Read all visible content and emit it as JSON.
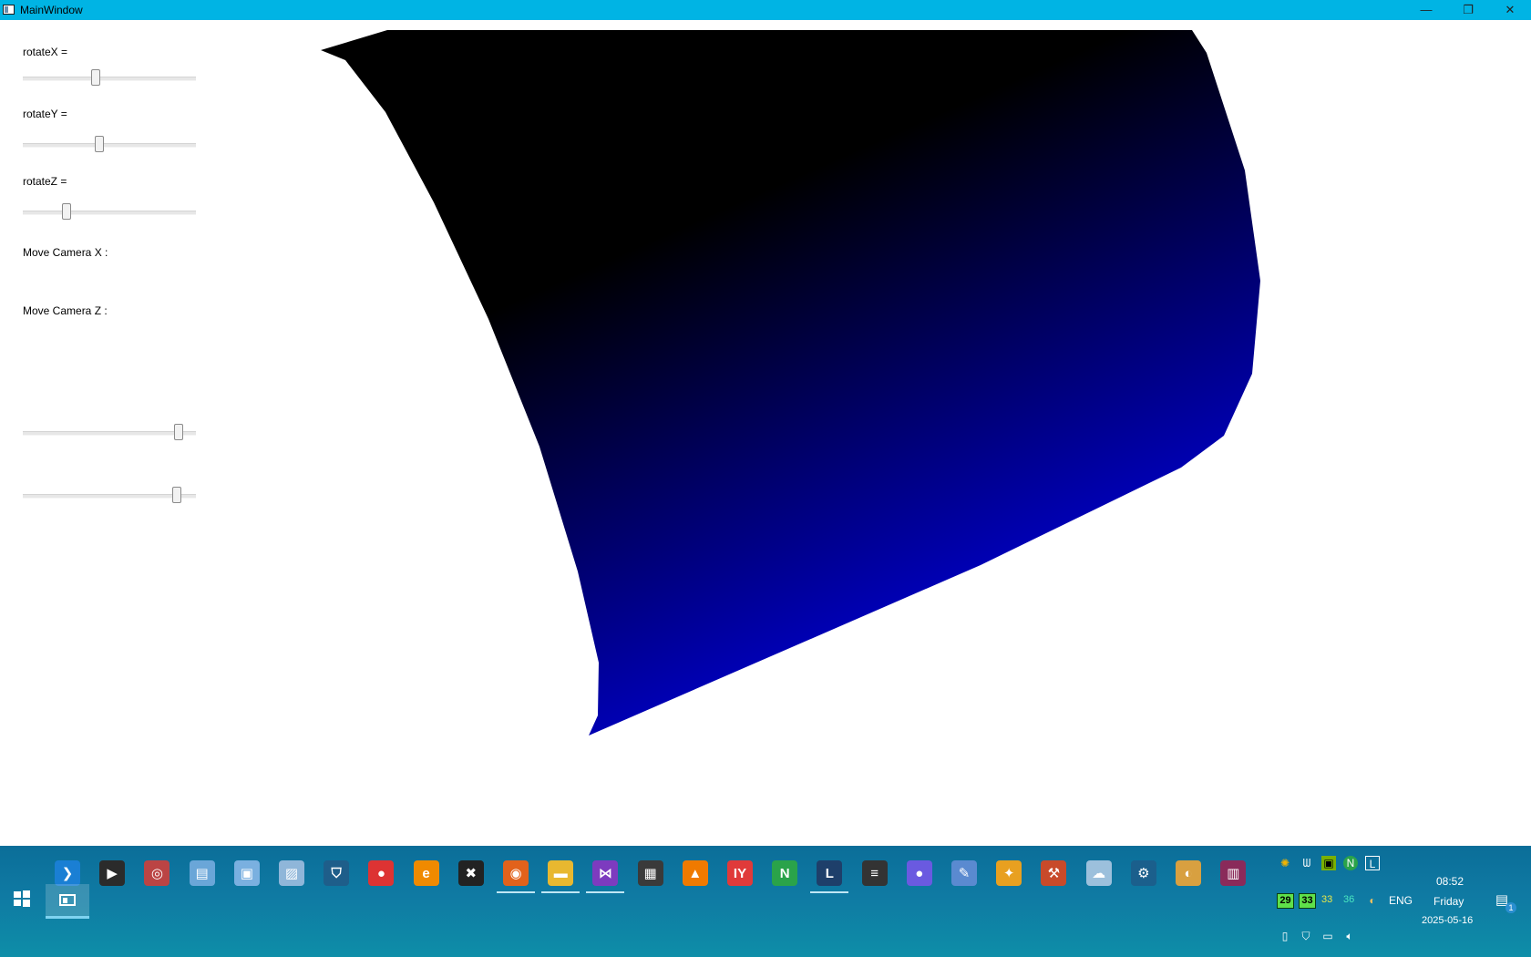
{
  "window": {
    "title": "MainWindow",
    "minimize": "—",
    "maximize": "❐",
    "close": "✕"
  },
  "controls": {
    "rotateX": {
      "label": "rotateX =",
      "value": 0.42
    },
    "rotateY": {
      "label": "rotateY =",
      "value": 0.44
    },
    "rotateZ": {
      "label": "rotateZ =",
      "value": 0.25
    },
    "moveCameraX": {
      "label": "Move Camera X :",
      "value": 0.9
    },
    "moveCameraZ": {
      "label": "Move Camera Z :",
      "value": 0.89
    }
  },
  "render": {
    "colors": {
      "top": "#000000",
      "bottom": "#0000d8",
      "background": "#ffffff"
    }
  },
  "taskbar": {
    "apps": [
      {
        "name": "vscode-icon",
        "glyph": "❯",
        "color": "#1a7fd4"
      },
      {
        "name": "media-player-icon",
        "glyph": "▶",
        "color": "#2b2b2b"
      },
      {
        "name": "globe-icon",
        "glyph": "◎",
        "color": "#b44"
      },
      {
        "name": "notes-icon",
        "glyph": "▤",
        "color": "#6aa6d8"
      },
      {
        "name": "image-viewer-icon",
        "glyph": "▣",
        "color": "#7ab0e0"
      },
      {
        "name": "photos-icon",
        "glyph": "▨",
        "color": "#8fb6d9"
      },
      {
        "name": "security-shield-icon",
        "glyph": "⛉",
        "color": "#1e5e8a"
      },
      {
        "name": "record-icon",
        "glyph": "●",
        "color": "#d33"
      },
      {
        "name": "browser-e-icon",
        "glyph": "e",
        "color": "#f08a00"
      },
      {
        "name": "x-app-icon",
        "glyph": "✖",
        "color": "#222"
      },
      {
        "name": "firefox-icon",
        "glyph": "◉",
        "color": "#e2621b"
      },
      {
        "name": "file-explorer-icon",
        "glyph": "▬",
        "color": "#e8b830"
      },
      {
        "name": "visual-studio-icon",
        "glyph": "⋈",
        "color": "#7d3bbf"
      },
      {
        "name": "calculator-icon",
        "glyph": "▦",
        "color": "#3a3a3a"
      },
      {
        "name": "vlc-icon",
        "glyph": "▲",
        "color": "#f07a00"
      },
      {
        "name": "iy-app-icon",
        "glyph": "IY",
        "color": "#e03a3a"
      },
      {
        "name": "n-app-icon",
        "glyph": "N",
        "color": "#2aa34a"
      },
      {
        "name": "l-app-icon",
        "glyph": "L",
        "color": "#1e3f6a"
      },
      {
        "name": "flag-app-icon",
        "glyph": "≡",
        "color": "#333"
      },
      {
        "name": "maps-pin-icon",
        "glyph": "●",
        "color": "#6a5ae0"
      },
      {
        "name": "paint-icon",
        "glyph": "✎",
        "color": "#5a8ad0"
      },
      {
        "name": "sticky-notes-icon",
        "glyph": "✦",
        "color": "#e8a020"
      },
      {
        "name": "tools-icon",
        "glyph": "⚒",
        "color": "#c84a2a"
      },
      {
        "name": "cloud-icon",
        "glyph": "☁",
        "color": "#9cc0dc"
      },
      {
        "name": "settings-gear-icon",
        "glyph": "⚙",
        "color": "#1b5f8c"
      },
      {
        "name": "weather-app-icon",
        "glyph": "◐",
        "color": "#d8a040"
      },
      {
        "name": "archive-icon",
        "glyph": "▥",
        "color": "#8a2a5a"
      }
    ],
    "tray": {
      "time": "08:52",
      "day": "Friday",
      "date": "2025-05-16",
      "language": "ENG",
      "temps": [
        "29",
        "33",
        "33",
        "36"
      ],
      "notifications": "1"
    }
  }
}
